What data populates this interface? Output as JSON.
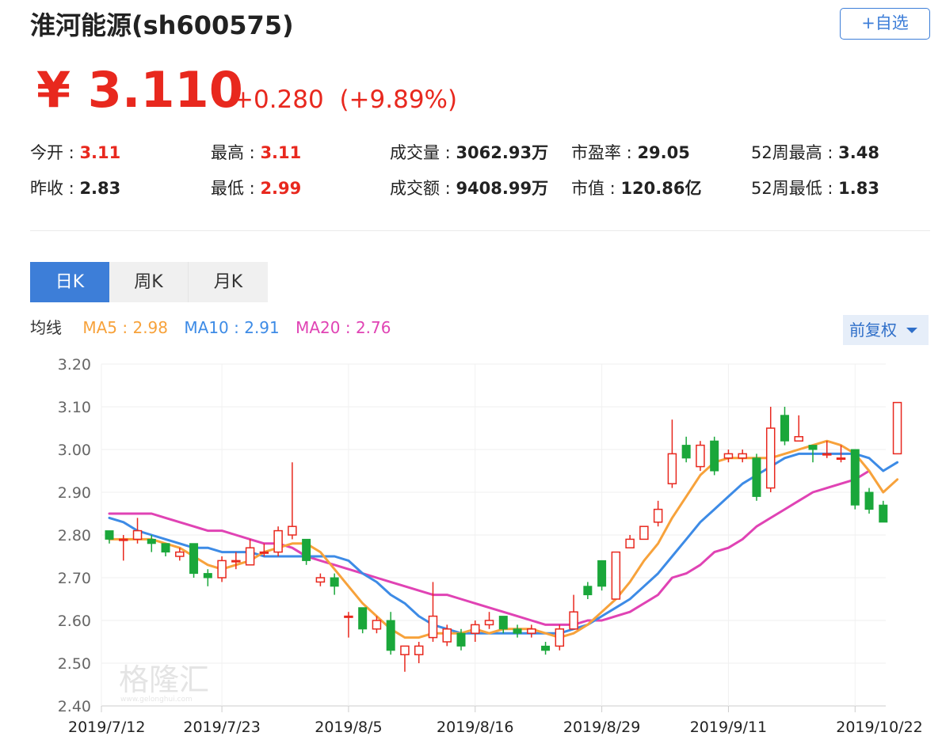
{
  "stock": {
    "name": "淮河能源(sh600575)",
    "price": "¥ 3.110",
    "change": "+0.280",
    "change_pct": "(+9.89%)"
  },
  "actions": {
    "add_watch": "+自选"
  },
  "quote": [
    {
      "label": "今开 : ",
      "value": "3.11",
      "color": "#e8281e"
    },
    {
      "label": "最高 : ",
      "value": "3.11",
      "color": "#e8281e"
    },
    {
      "label": "成交量 : ",
      "value": "3062.93万",
      "color": "#222222"
    },
    {
      "label": "市盈率 : ",
      "value": "29.05",
      "color": "#222222"
    },
    {
      "label": "52周最高 : ",
      "value": "3.48",
      "color": "#222222"
    },
    {
      "label": "昨收 : ",
      "value": "2.83",
      "color": "#222222"
    },
    {
      "label": "最低 : ",
      "value": "2.99",
      "color": "#e8281e"
    },
    {
      "label": "成交额 : ",
      "value": "9408.99万",
      "color": "#222222"
    },
    {
      "label": "市值 : ",
      "value": "120.86亿",
      "color": "#222222"
    },
    {
      "label": "52周最低 : ",
      "value": "1.83",
      "color": "#222222"
    }
  ],
  "tabs": [
    "日K",
    "周K",
    "月K"
  ],
  "ma_legend": {
    "title": "均线",
    "ma5": "MA5 : 2.98",
    "ma10": "MA10 : 2.91",
    "ma20": "MA20 : 2.76"
  },
  "adjust": {
    "label": "前复权"
  },
  "watermark": {
    "text": "格隆汇",
    "sub": "www.gelonghui.com"
  },
  "colors": {
    "up": "#e8281e",
    "down": "#1aa73a",
    "ma5": "#f7a23b",
    "ma10": "#3d8be6",
    "ma20": "#e043b4",
    "accent": "#3d7ed8"
  },
  "chart_data": {
    "type": "candlestick",
    "ylim": [
      2.4,
      3.2
    ],
    "yticks": [
      "3.20",
      "3.10",
      "3.00",
      "2.90",
      "2.80",
      "2.70",
      "2.60",
      "2.50",
      "2.40"
    ],
    "xticks": [
      {
        "index": 0,
        "label": "2019/7/12"
      },
      {
        "index": 8,
        "label": "2019/7/23"
      },
      {
        "index": 17,
        "label": "2019/8/5"
      },
      {
        "index": 26,
        "label": "2019/8/16"
      },
      {
        "index": 35,
        "label": "2019/8/29"
      },
      {
        "index": 44,
        "label": "2019/9/11"
      },
      {
        "index": 53,
        "label": "2019/10/22"
      }
    ],
    "candles": [
      [
        2.81,
        2.79,
        2.81,
        2.78
      ],
      [
        2.79,
        2.79,
        2.8,
        2.74
      ],
      [
        2.79,
        2.81,
        2.84,
        2.78
      ],
      [
        2.79,
        2.78,
        2.8,
        2.76
      ],
      [
        2.78,
        2.76,
        2.78,
        2.75
      ],
      [
        2.75,
        2.76,
        2.77,
        2.74
      ],
      [
        2.78,
        2.71,
        2.78,
        2.7
      ],
      [
        2.71,
        2.7,
        2.72,
        2.68
      ],
      [
        2.7,
        2.74,
        2.75,
        2.69
      ],
      [
        2.74,
        2.74,
        2.76,
        2.72
      ],
      [
        2.73,
        2.77,
        2.79,
        2.73
      ],
      [
        2.76,
        2.76,
        2.78,
        2.75
      ],
      [
        2.76,
        2.81,
        2.82,
        2.75
      ],
      [
        2.8,
        2.82,
        2.97,
        2.79
      ],
      [
        2.79,
        2.74,
        2.79,
        2.73
      ],
      [
        2.69,
        2.7,
        2.71,
        2.68
      ],
      [
        2.7,
        2.68,
        2.71,
        2.66
      ],
      [
        2.61,
        2.61,
        2.62,
        2.56
      ],
      [
        2.63,
        2.58,
        2.63,
        2.57
      ],
      [
        2.58,
        2.6,
        2.61,
        2.57
      ],
      [
        2.6,
        2.53,
        2.62,
        2.52
      ],
      [
        2.52,
        2.54,
        2.54,
        2.48
      ],
      [
        2.52,
        2.54,
        2.55,
        2.5
      ],
      [
        2.56,
        2.61,
        2.69,
        2.55
      ],
      [
        2.55,
        2.58,
        2.59,
        2.54
      ],
      [
        2.57,
        2.54,
        2.58,
        2.53
      ],
      [
        2.57,
        2.59,
        2.6,
        2.55
      ],
      [
        2.59,
        2.6,
        2.62,
        2.58
      ],
      [
        2.61,
        2.58,
        2.61,
        2.57
      ],
      [
        2.58,
        2.57,
        2.59,
        2.56
      ],
      [
        2.57,
        2.58,
        2.59,
        2.56
      ],
      [
        2.54,
        2.53,
        2.55,
        2.52
      ],
      [
        2.54,
        2.58,
        2.59,
        2.53
      ],
      [
        2.58,
        2.62,
        2.66,
        2.58
      ],
      [
        2.68,
        2.66,
        2.69,
        2.65
      ],
      [
        2.74,
        2.68,
        2.74,
        2.67
      ],
      [
        2.65,
        2.76,
        2.76,
        2.65
      ],
      [
        2.77,
        2.79,
        2.8,
        2.77
      ],
      [
        2.79,
        2.82,
        2.82,
        2.79
      ],
      [
        2.83,
        2.86,
        2.88,
        2.82
      ],
      [
        2.92,
        2.99,
        3.07,
        2.91
      ],
      [
        3.01,
        2.98,
        3.03,
        2.97
      ],
      [
        2.96,
        3.01,
        3.02,
        2.95
      ],
      [
        3.02,
        2.95,
        3.03,
        2.94
      ],
      [
        2.98,
        2.99,
        3.0,
        2.97
      ],
      [
        2.98,
        2.99,
        3.0,
        2.97
      ],
      [
        2.98,
        2.89,
        2.99,
        2.88
      ],
      [
        2.91,
        3.05,
        3.1,
        2.9
      ],
      [
        3.08,
        3.02,
        3.1,
        3.01
      ],
      [
        3.02,
        3.03,
        3.08,
        3.02
      ],
      [
        3.01,
        3.0,
        3.01,
        2.97
      ],
      [
        2.99,
        2.99,
        3.02,
        2.98
      ],
      [
        2.98,
        2.98,
        3.01,
        2.97
      ],
      [
        3.0,
        2.87,
        3.0,
        2.86
      ],
      [
        2.9,
        2.86,
        2.91,
        2.85
      ],
      [
        2.87,
        2.83,
        2.88,
        2.83
      ],
      [
        2.99,
        3.11,
        3.11,
        2.99
      ]
    ],
    "ma5": [
      2.79,
      2.79,
      2.79,
      2.79,
      2.78,
      2.77,
      2.75,
      2.73,
      2.72,
      2.73,
      2.74,
      2.76,
      2.77,
      2.78,
      2.78,
      2.76,
      2.72,
      2.68,
      2.64,
      2.61,
      2.58,
      2.56,
      2.56,
      2.57,
      2.57,
      2.57,
      2.58,
      2.57,
      2.58,
      2.58,
      2.58,
      2.57,
      2.56,
      2.57,
      2.59,
      2.62,
      2.65,
      2.69,
      2.74,
      2.78,
      2.84,
      2.89,
      2.94,
      2.97,
      2.98,
      2.98,
      2.98,
      2.98,
      2.99,
      3.0,
      3.01,
      3.02,
      3.01,
      2.99,
      2.95,
      2.9,
      2.93
    ],
    "ma10": [
      2.84,
      2.83,
      2.81,
      2.8,
      2.79,
      2.78,
      2.77,
      2.77,
      2.76,
      2.76,
      2.76,
      2.75,
      2.75,
      2.75,
      2.75,
      2.75,
      2.75,
      2.74,
      2.71,
      2.69,
      2.66,
      2.64,
      2.61,
      2.59,
      2.58,
      2.57,
      2.57,
      2.57,
      2.57,
      2.57,
      2.57,
      2.57,
      2.57,
      2.58,
      2.59,
      2.61,
      2.63,
      2.65,
      2.68,
      2.71,
      2.75,
      2.79,
      2.83,
      2.86,
      2.89,
      2.92,
      2.94,
      2.96,
      2.98,
      2.99,
      2.99,
      2.99,
      2.99,
      2.99,
      2.98,
      2.95,
      2.97
    ],
    "ma20": [
      2.85,
      2.85,
      2.85,
      2.85,
      2.84,
      2.83,
      2.82,
      2.81,
      2.81,
      2.8,
      2.79,
      2.78,
      2.78,
      2.77,
      2.75,
      2.74,
      2.73,
      2.72,
      2.71,
      2.7,
      2.69,
      2.68,
      2.67,
      2.66,
      2.66,
      2.65,
      2.64,
      2.63,
      2.62,
      2.61,
      2.6,
      2.59,
      2.59,
      2.59,
      2.6,
      2.6,
      2.61,
      2.62,
      2.64,
      2.66,
      2.7,
      2.71,
      2.73,
      2.76,
      2.77,
      2.79,
      2.82,
      2.84,
      2.86,
      2.88,
      2.9,
      2.91,
      2.92,
      2.93,
      2.95
    ]
  }
}
